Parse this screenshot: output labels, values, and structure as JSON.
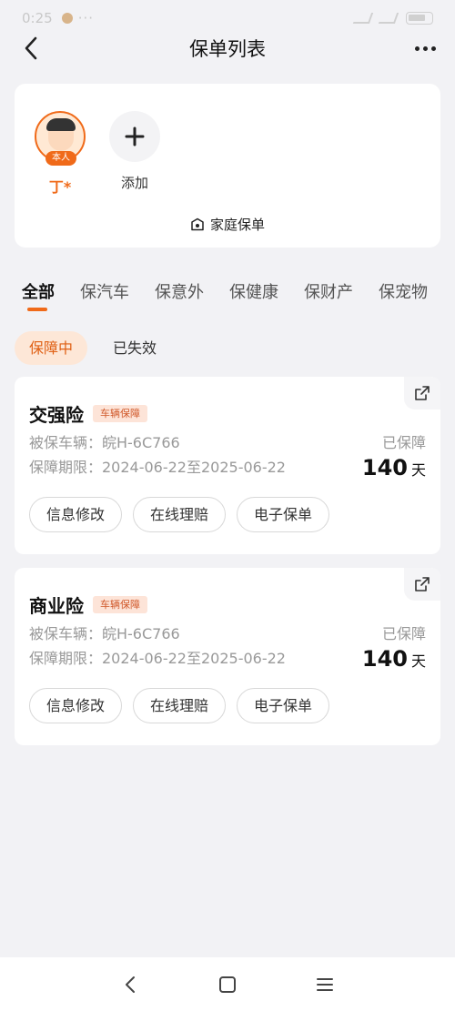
{
  "status_bar": {
    "time": "0:25",
    "dots": "···"
  },
  "header": {
    "title": "保单列表"
  },
  "family": {
    "members": [
      {
        "name": "丁*",
        "badge": "本人"
      }
    ],
    "add_label": "添加",
    "family_policy_label": "家庭保单"
  },
  "tabs": [
    "全部",
    "保汽车",
    "保意外",
    "保健康",
    "保财产",
    "保宠物"
  ],
  "subtabs": [
    "保障中",
    "已失效"
  ],
  "policies": [
    {
      "name": "交强险",
      "tag": "车辆保障",
      "vehicle": "被保车辆：皖H-6C766",
      "period": "保障期限：2024-06-22至2025-06-22",
      "guard_label": "已保障",
      "guard_days": "140",
      "guard_unit": "天",
      "actions": [
        "信息修改",
        "在线理赔",
        "电子保单"
      ]
    },
    {
      "name": "商业险",
      "tag": "车辆保障",
      "vehicle": "被保车辆：皖H-6C766",
      "period": "保障期限：2024-06-22至2025-06-22",
      "guard_label": "已保障",
      "guard_days": "140",
      "guard_unit": "天",
      "actions": [
        "信息修改",
        "在线理赔",
        "电子保单"
      ]
    }
  ],
  "colors": {
    "accent": "#f06a19",
    "background": "#f2f2f5",
    "tag_bg": "#fde4d8"
  }
}
